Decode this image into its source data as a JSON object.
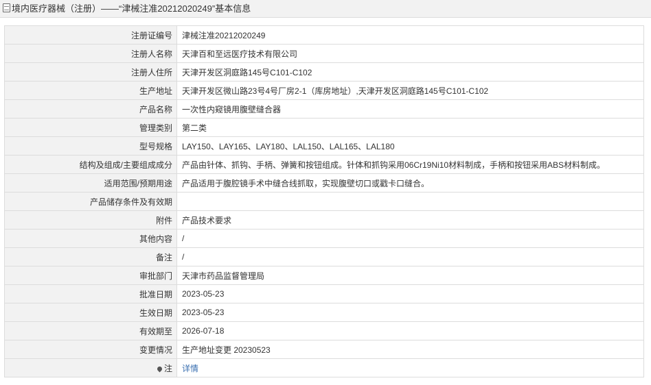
{
  "header": {
    "title": "境内医疗器械（注册）——“津械注准20212020249”基本信息"
  },
  "rows": [
    {
      "label": "注册证编号",
      "value": "津械注准20212020249"
    },
    {
      "label": "注册人名称",
      "value": "天津百和至远医疗技术有限公司"
    },
    {
      "label": "注册人住所",
      "value": "天津开发区洞庭路145号C101-C102"
    },
    {
      "label": "生产地址",
      "value": "天津开发区微山路23号4号厂房2-1（库房地址）,天津开发区洞庭路145号C101-C102"
    },
    {
      "label": "产品名称",
      "value": "一次性内窥镜用腹壁缝合器"
    },
    {
      "label": "管理类别",
      "value": "第二类"
    },
    {
      "label": "型号规格",
      "value": "LAY150、LAY165、LAY180、LAL150、LAL165、LAL180"
    },
    {
      "label": "结构及组成/主要组成成分",
      "value": "产品由针体、抓钩、手柄、弹簧和按钮组成。针体和抓钩采用06Cr19Ni10材料制成，手柄和按钮采用ABS材料制成。"
    },
    {
      "label": "适用范围/预期用途",
      "value": "产品适用于腹腔镜手术中缝合线抓取，实现腹壁切口或戳卡口缝合。"
    },
    {
      "label": "产品储存条件及有效期",
      "value": ""
    },
    {
      "label": "附件",
      "value": "产品技术要求"
    },
    {
      "label": "其他内容",
      "value": "/"
    },
    {
      "label": "备注",
      "value": "/"
    },
    {
      "label": "审批部门",
      "value": "天津市药品监督管理局"
    },
    {
      "label": "批准日期",
      "value": "2023-05-23"
    },
    {
      "label": "生效日期",
      "value": "2023-05-23"
    },
    {
      "label": "有效期至",
      "value": "2026-07-18"
    },
    {
      "label": "变更情况",
      "value": "生产地址变更 20230523"
    }
  ],
  "note_row": {
    "label": "注",
    "link_text": "详情",
    "icon": "location-pin-icon"
  }
}
